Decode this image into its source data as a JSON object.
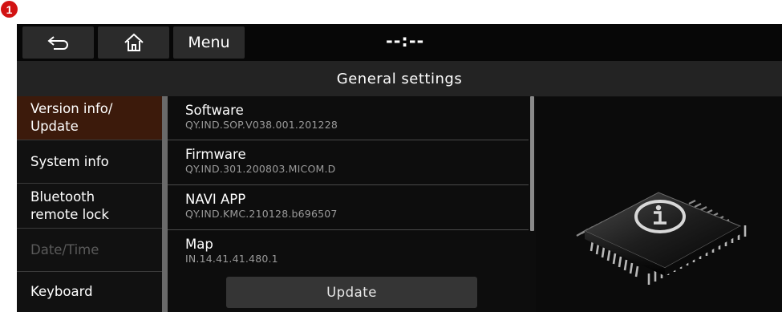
{
  "marker": {
    "label": "1"
  },
  "topbar": {
    "back_icon": "back-arrow-icon",
    "home_icon": "home-icon",
    "menu_label": "Menu",
    "clock": "--:--"
  },
  "title": "General settings",
  "sidebar": {
    "items": [
      {
        "line1": "Version info/",
        "line2": "Update",
        "state": "active"
      },
      {
        "line1": "System info",
        "line2": "",
        "state": "normal"
      },
      {
        "line1": "Bluetooth",
        "line2": "remote lock",
        "state": "normal"
      },
      {
        "line1": "Date/Time",
        "line2": "",
        "state": "disabled"
      },
      {
        "line1": "Keyboard",
        "line2": "",
        "state": "normal"
      }
    ]
  },
  "content": {
    "rows": [
      {
        "name": "Software",
        "value": "QY.IND.SOP.V038.001.201228"
      },
      {
        "name": "Firmware",
        "value": "QY.IND.301.200803.MICOM.D"
      },
      {
        "name": "NAVI APP",
        "value": "QY.IND.KMC.210128.b696507"
      },
      {
        "name": "Map",
        "value": "IN.14.41.41.480.1"
      }
    ],
    "update_label": "Update"
  },
  "illustration": {
    "icon": "info-chip-icon"
  },
  "colors": {
    "active_item": "#3c1a0b",
    "marker": "#d21313"
  }
}
